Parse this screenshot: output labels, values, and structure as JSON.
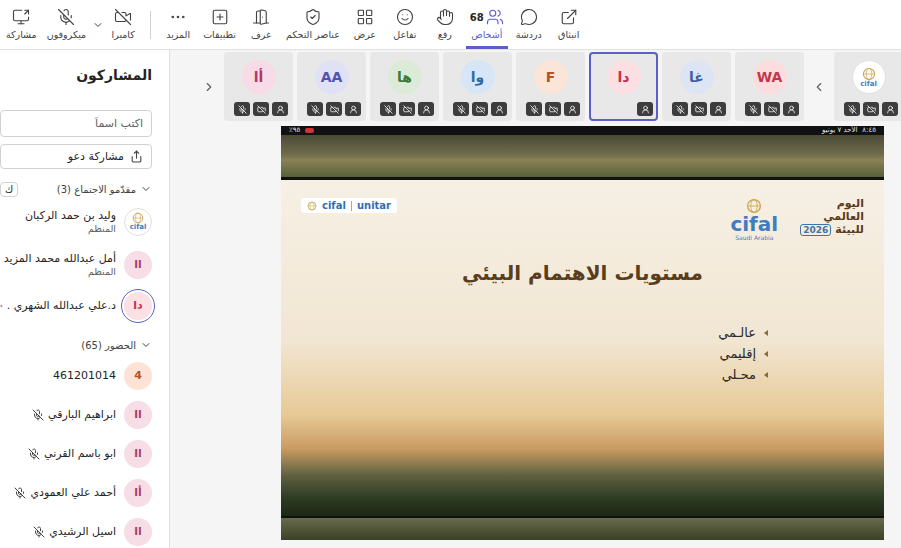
{
  "toolbar": {
    "buttons": [
      {
        "label": "مشاركة",
        "group": "devices",
        "selected": false,
        "dropdown": false,
        "off": false
      },
      {
        "label": "ميكروفون",
        "group": "devices",
        "selected": false,
        "dropdown": false,
        "off": true
      },
      {
        "label": "كاميرا",
        "group": "devices",
        "selected": false,
        "dropdown": true,
        "off": true
      },
      {
        "label": "المزيد",
        "group": "meeting",
        "selected": false,
        "dropdown": false,
        "off": false
      },
      {
        "label": "تطبيقات",
        "group": "meeting",
        "selected": false,
        "dropdown": false,
        "off": false
      },
      {
        "label": "غرف",
        "group": "meeting",
        "selected": false,
        "dropdown": false,
        "off": false
      },
      {
        "label": "عناصر التحكم",
        "group": "meeting",
        "selected": false,
        "dropdown": false,
        "off": false
      },
      {
        "label": "عرض",
        "group": "meeting",
        "selected": false,
        "dropdown": false,
        "off": false
      },
      {
        "label": "تفاعل",
        "group": "meeting",
        "selected": false,
        "dropdown": false,
        "off": false
      },
      {
        "label": "رفع",
        "group": "meeting",
        "selected": false,
        "dropdown": false,
        "off": false
      },
      {
        "label": "أشخاص",
        "group": "meeting",
        "selected": true,
        "dropdown": false,
        "off": false,
        "count": "68"
      },
      {
        "label": "دردشة",
        "group": "meeting",
        "selected": false,
        "dropdown": false,
        "off": false
      },
      {
        "label": "انبثاق",
        "group": "meeting",
        "selected": false,
        "dropdown": false,
        "off": false
      }
    ]
  },
  "panel": {
    "title": "المشاركون",
    "search_placeholder": "اكتب اسماً",
    "invite_label": "مشاركة دعو",
    "extra_label": "ك",
    "sections": [
      {
        "title": "مقدّمو الاجتماع (3)",
        "expanded": true,
        "people": [
          {
            "name": "وليد بن حمد الركبان",
            "role": "المنظم",
            "avatar": "cifal",
            "kind": "logo",
            "color": "#ffffff",
            "ink": "#3f7cc0",
            "muted": false,
            "selected": false
          },
          {
            "name": "أمل عبدالله محمد المزيد",
            "role": "المنظم",
            "avatar": "اا",
            "kind": "initials",
            "color": "#f6dde6",
            "ink": "#a83d6c",
            "muted": false,
            "selected": false
          },
          {
            "name": "د.علي عبدالله الشهري .",
            "avatar": "دا",
            "kind": "initials",
            "color": "#fbe1e4",
            "ink": "#c4314b",
            "muted": true,
            "selected": true
          }
        ]
      },
      {
        "title": "الحضور (65)",
        "expanded": true,
        "people": [
          {
            "name": "461201014",
            "avatar": "4",
            "kind": "initials",
            "color": "#fde3d6",
            "ink": "#b5542a",
            "muted": false,
            "selected": false
          },
          {
            "name": "ابراهيم البارقي",
            "avatar": "اا",
            "kind": "initials",
            "color": "#f6dde6",
            "ink": "#a83d6c",
            "muted": true,
            "selected": false
          },
          {
            "name": "ابو باسم القرني",
            "avatar": "اا",
            "kind": "initials",
            "color": "#f6dde6",
            "ink": "#a83d6c",
            "muted": true,
            "selected": false
          },
          {
            "name": "أحمد علي العمودي",
            "avatar": "أا",
            "kind": "initials",
            "color": "#f6dde6",
            "ink": "#a83d6c",
            "muted": true,
            "selected": false
          },
          {
            "name": "اسيل الرشيدي",
            "avatar": "اا",
            "kind": "initials",
            "color": "#f6dde6",
            "ink": "#a83d6c",
            "muted": true,
            "selected": false
          }
        ]
      }
    ]
  },
  "strip": {
    "tiles": [
      {
        "initials": "أا",
        "kind": "initials",
        "color": "#f7dbe6",
        "ink": "#b0386a",
        "muted": true,
        "camera_off": true,
        "selected": false
      },
      {
        "initials": "AA",
        "kind": "initials",
        "color": "#e1e1f5",
        "ink": "#4f52b2",
        "muted": true,
        "camera_off": true,
        "selected": false
      },
      {
        "initials": "ها",
        "kind": "initials",
        "color": "#dcebd7",
        "ink": "#3b7a3a",
        "muted": true,
        "camera_off": true,
        "selected": false
      },
      {
        "initials": "وا",
        "kind": "initials",
        "color": "#d7e6f7",
        "ink": "#2f6aa6",
        "muted": true,
        "camera_off": true,
        "selected": false
      },
      {
        "initials": "F",
        "kind": "initials",
        "color": "#fbe4d8",
        "ink": "#b5542a",
        "muted": true,
        "camera_off": true,
        "selected": false
      },
      {
        "initials": "دا",
        "kind": "initials",
        "color": "#fbdfe3",
        "ink": "#c4314b",
        "muted": false,
        "camera_off": false,
        "selected": true
      },
      {
        "initials": "غا",
        "kind": "initials",
        "color": "#dde5f4",
        "ink": "#3d5fa8",
        "muted": true,
        "camera_off": true,
        "selected": false
      },
      {
        "initials": "WA",
        "kind": "initials",
        "color": "#fbdde0",
        "ink": "#c23848",
        "muted": true,
        "camera_off": true,
        "selected": false
      },
      {
        "initials": "cifal",
        "kind": "logo",
        "color": "#ffffff",
        "ink": "#3f7cc0",
        "muted": true,
        "camera_off": true,
        "selected": false
      }
    ]
  },
  "share": {
    "status": {
      "time": "٨:٤٥",
      "date": "الأحد ٧ يونيو",
      "battery": "٩٥٪"
    },
    "slide": {
      "event_lines": [
        "اليوم",
        "العالمي",
        "للبيئة"
      ],
      "year": "2026",
      "logo": "cifal",
      "logo_sub": "Saudi Arabia",
      "partner": "unitar",
      "title": "مستويات الاهتمام البيئي",
      "bullets": [
        "عالـمي",
        "إقليمي",
        "محـلي"
      ]
    }
  }
}
